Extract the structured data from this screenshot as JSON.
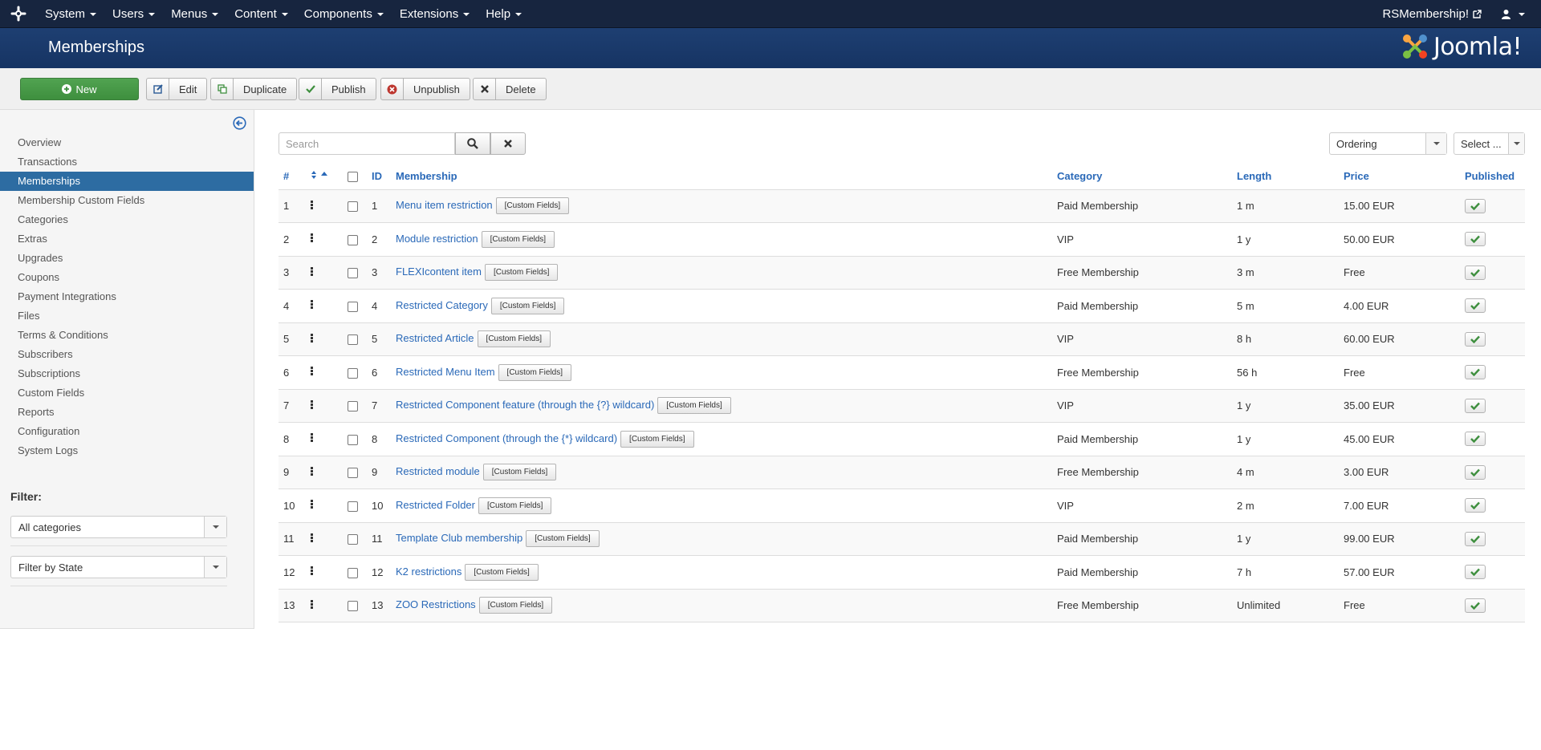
{
  "topnav": {
    "menus": [
      "System",
      "Users",
      "Menus",
      "Content",
      "Components",
      "Extensions",
      "Help"
    ],
    "site_link": "RSMembership!"
  },
  "header": {
    "title": "Memberships",
    "brand": "Joomla!"
  },
  "toolbar": {
    "new": "New",
    "edit": "Edit",
    "duplicate": "Duplicate",
    "publish": "Publish",
    "unpublish": "Unpublish",
    "delete": "Delete"
  },
  "sidebar": {
    "items": [
      "Overview",
      "Transactions",
      "Memberships",
      "Membership Custom Fields",
      "Categories",
      "Extras",
      "Upgrades",
      "Coupons",
      "Payment Integrations",
      "Files",
      "Terms & Conditions",
      "Subscribers",
      "Subscriptions",
      "Custom Fields",
      "Reports",
      "Configuration",
      "System Logs"
    ],
    "active_index": 2,
    "filter_title": "Filter:",
    "filter_category": "All categories",
    "filter_state": "Filter by State"
  },
  "search": {
    "placeholder": "Search",
    "ordering": "Ordering",
    "limit": "Select ..."
  },
  "table": {
    "headers": {
      "num": "#",
      "id": "ID",
      "membership": "Membership",
      "category": "Category",
      "length": "Length",
      "price": "Price",
      "published": "Published"
    },
    "custom_fields_label": "[Custom Fields]",
    "rows": [
      {
        "num": "1",
        "id": "1",
        "name": "Menu item restriction",
        "category": "Paid Membership",
        "length": "1 m",
        "price": "15.00 EUR"
      },
      {
        "num": "2",
        "id": "2",
        "name": "Module restriction",
        "category": "VIP",
        "length": "1 y",
        "price": "50.00 EUR"
      },
      {
        "num": "3",
        "id": "3",
        "name": "FLEXIcontent item",
        "category": "Free Membership",
        "length": "3 m",
        "price": "Free"
      },
      {
        "num": "4",
        "id": "4",
        "name": "Restricted Category",
        "category": "Paid Membership",
        "length": "5 m",
        "price": "4.00 EUR"
      },
      {
        "num": "5",
        "id": "5",
        "name": "Restricted Article",
        "category": "VIP",
        "length": "8 h",
        "price": "60.00 EUR"
      },
      {
        "num": "6",
        "id": "6",
        "name": "Restricted Menu Item",
        "category": "Free Membership",
        "length": "56 h",
        "price": "Free"
      },
      {
        "num": "7",
        "id": "7",
        "name": "Restricted Component feature (through the {?} wildcard)",
        "category": "VIP",
        "length": "1 y",
        "price": "35.00 EUR"
      },
      {
        "num": "8",
        "id": "8",
        "name": "Restricted Component (through the {*} wildcard)",
        "category": "Paid Membership",
        "length": "1 y",
        "price": "45.00 EUR"
      },
      {
        "num": "9",
        "id": "9",
        "name": "Restricted module",
        "category": "Free Membership",
        "length": "4 m",
        "price": "3.00 EUR"
      },
      {
        "num": "10",
        "id": "10",
        "name": "Restricted Folder",
        "category": "VIP",
        "length": "2 m",
        "price": "7.00 EUR"
      },
      {
        "num": "11",
        "id": "11",
        "name": "Template Club membership",
        "category": "Paid Membership",
        "length": "1 y",
        "price": "99.00 EUR"
      },
      {
        "num": "12",
        "id": "12",
        "name": "K2 restrictions",
        "category": "Paid Membership",
        "length": "7 h",
        "price": "57.00 EUR"
      },
      {
        "num": "13",
        "id": "13",
        "name": "ZOO Restrictions",
        "category": "Free Membership",
        "length": "Unlimited",
        "price": "Free"
      }
    ]
  }
}
